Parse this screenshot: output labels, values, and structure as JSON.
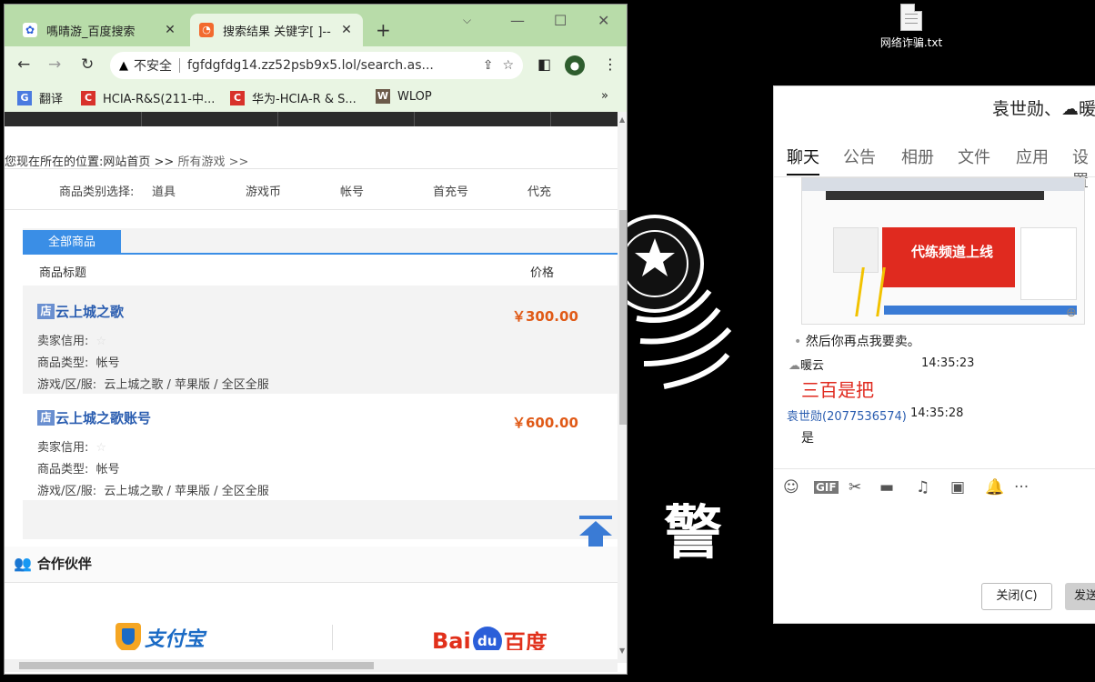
{
  "desktop": {
    "file_name": "网络诈骗.txt",
    "police_char": "警"
  },
  "browser": {
    "tabs": [
      {
        "title": "嗎晴游_百度搜索",
        "close": "✕"
      },
      {
        "title": "搜索结果 关键字[ ]--",
        "close": "✕"
      }
    ],
    "new_tab": "+",
    "window_controls": {
      "minimize": "—",
      "restore": "☐",
      "close": "✕"
    },
    "nav": {
      "back": "←",
      "forward": "→",
      "reload": "↻"
    },
    "omnibox": {
      "security_label": "不安全",
      "url": "fgfdgfdg14.zz52psb9x5.lol/search.as..."
    },
    "bookmarks": [
      {
        "label": "翻译"
      },
      {
        "label": "HCIA-R&S(211-中..."
      },
      {
        "label": "华为-HCIA-R & S..."
      },
      {
        "label": "WLOP"
      }
    ],
    "bookmarks_more": "»"
  },
  "page": {
    "breadcrumb": {
      "prefix": "您现在所在的位置:网站首页 >> ",
      "current": "所有游戏 >>"
    },
    "categories": {
      "label": "商品类别选择:",
      "items": [
        "道具",
        "游戏币",
        "帐号",
        "首充号",
        "代充"
      ]
    },
    "panel": {
      "tab_label": "全部商品",
      "col_title": "商品标题",
      "col_price": "价格"
    },
    "products": [
      {
        "shop_badge": "店",
        "name": "云上城之歌",
        "price": "￥300.00",
        "seller_credit_label": "卖家信用:",
        "type_label": "商品类型:",
        "type_value": "帐号",
        "server_label": "游戏/区/服:",
        "server_value": "云上城之歌 / 苹果版 / 全区全服"
      },
      {
        "shop_badge": "店",
        "name": "云上城之歌账号",
        "price": "￥600.00",
        "seller_credit_label": "卖家信用:",
        "type_label": "商品类型:",
        "type_value": "帐号",
        "server_label": "游戏/区/服:",
        "server_value": "云上城之歌 / 苹果版 / 全区全服"
      }
    ],
    "partners": {
      "heading": "合作伙伴",
      "alipay": "支付宝",
      "baidu_left": "Bai",
      "baidu_du": "du",
      "baidu_right": "百度"
    }
  },
  "qq": {
    "title": "袁世勋、☁暖",
    "tabs": [
      "聊天",
      "公告",
      "相册",
      "文件",
      "应用",
      "设置"
    ],
    "screenshot_banner": "代练频道上线",
    "messages": [
      {
        "text": "然后你再点我要卖。"
      },
      {
        "sender": "暖云",
        "time": "14:35:23",
        "text": "三百是把"
      },
      {
        "sender": "袁世勋(2077536574)",
        "time": "14:35:28",
        "text": "是"
      }
    ],
    "tools": [
      "☺",
      "GIF",
      "✂",
      "▬",
      "♫",
      "▣",
      "🔔",
      "···"
    ],
    "close_button": "关闭(C)",
    "send_button": "发送"
  },
  "colors": {
    "tabbar_bg": "#b8dca9",
    "accent_blue": "#3a8ee6",
    "price_orange": "#e05a17",
    "alert_red": "#e02a1f"
  }
}
